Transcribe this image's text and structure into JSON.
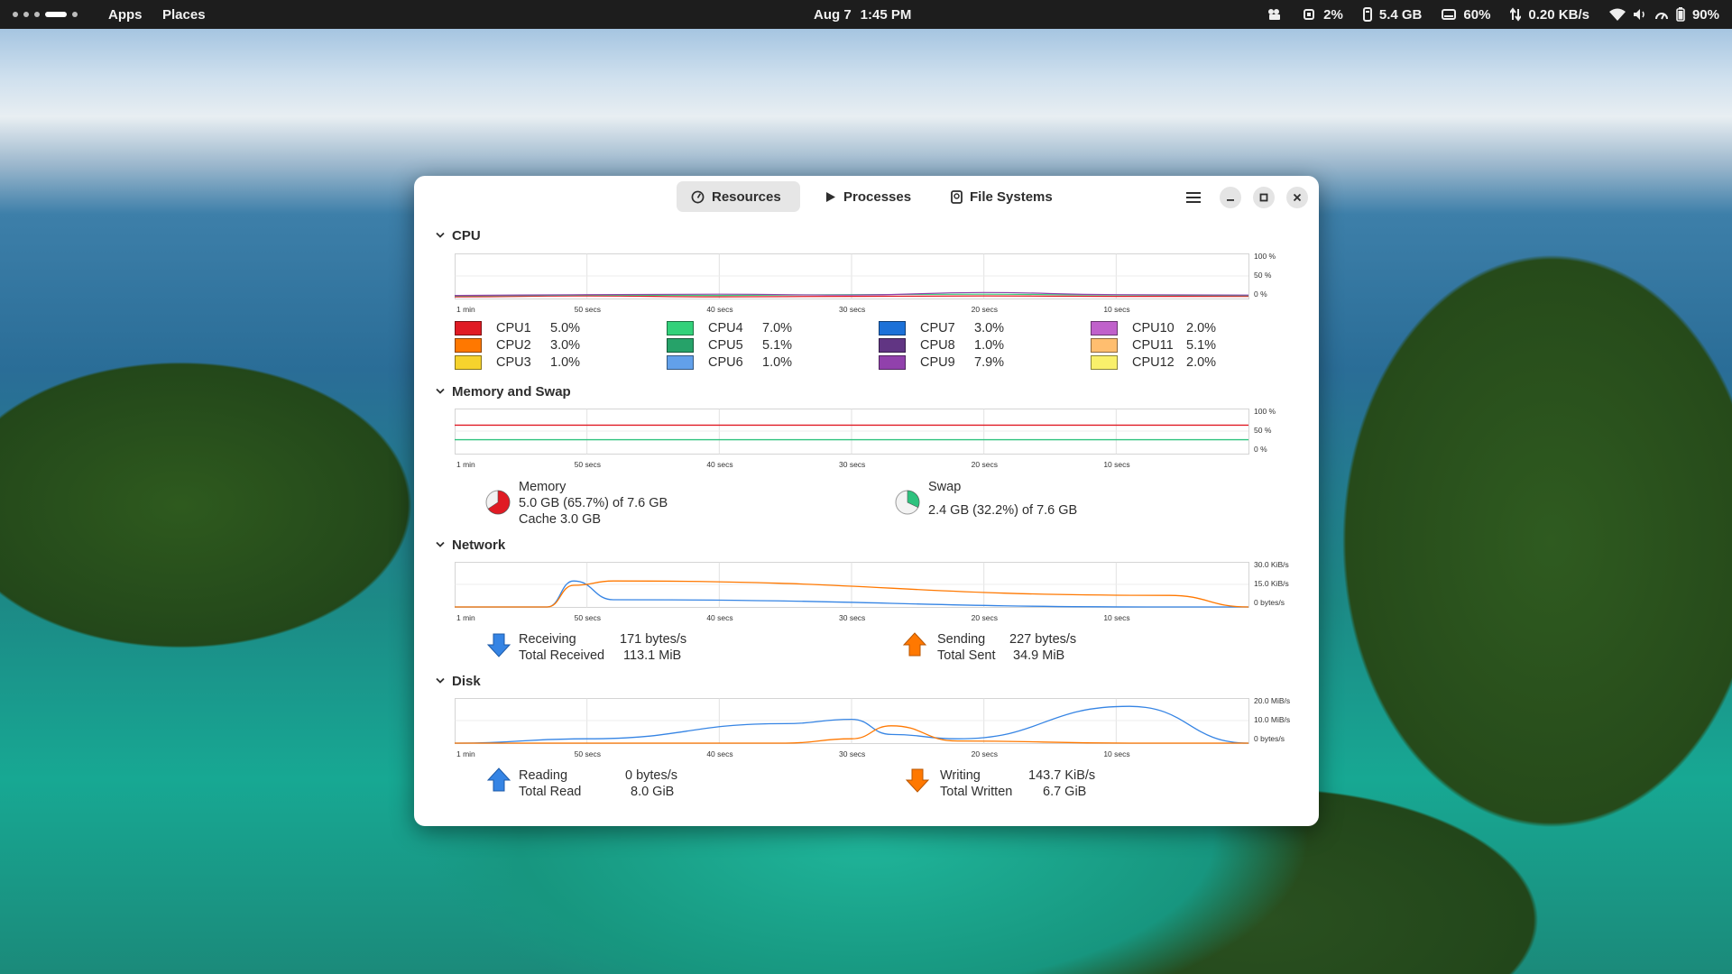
{
  "topbar": {
    "apps": "Apps",
    "places": "Places",
    "date": "Aug 7",
    "time": "1:45 PM",
    "cpu": "2%",
    "memory": "5.4 GB",
    "disk": "60%",
    "network": "0.20 KB/s",
    "battery": "90%"
  },
  "window": {
    "tabs": {
      "resources": "Resources",
      "processes": "Processes",
      "filesystems": "File Systems"
    }
  },
  "sections": {
    "cpu": "CPU",
    "memory": "Memory and Swap",
    "network": "Network",
    "disk": "Disk"
  },
  "axes": {
    "time_ticks": [
      "1 min",
      "50 secs",
      "40 secs",
      "30 secs",
      "20 secs",
      "10 secs"
    ],
    "percent_ticks": [
      "100 %",
      "50 %",
      "0 %"
    ],
    "network_ticks": [
      "30.0 KiB/s",
      "15.0 KiB/s",
      "0 bytes/s"
    ],
    "disk_ticks": [
      "20.0 MiB/s",
      "10.0 MiB/s",
      "0 bytes/s"
    ]
  },
  "cpus": [
    {
      "name": "CPU1",
      "value": "5.0%",
      "color": "#e01b24"
    },
    {
      "name": "CPU2",
      "value": "3.0%",
      "color": "#ff7800"
    },
    {
      "name": "CPU3",
      "value": "1.0%",
      "color": "#f6d32d"
    },
    {
      "name": "CPU4",
      "value": "7.0%",
      "color": "#33d17a"
    },
    {
      "name": "CPU5",
      "value": "5.1%",
      "color": "#26a269"
    },
    {
      "name": "CPU6",
      "value": "1.0%",
      "color": "#62a0ea"
    },
    {
      "name": "CPU7",
      "value": "3.0%",
      "color": "#1c71d8"
    },
    {
      "name": "CPU8",
      "value": "1.0%",
      "color": "#613583"
    },
    {
      "name": "CPU9",
      "value": "7.9%",
      "color": "#9141ac"
    },
    {
      "name": "CPU10",
      "value": "2.0%",
      "color": "#c061cb"
    },
    {
      "name": "CPU11",
      "value": "5.1%",
      "color": "#ffbe6f"
    },
    {
      "name": "CPU12",
      "value": "2.0%",
      "color": "#f9f06b"
    }
  ],
  "memory": {
    "label": "Memory",
    "usage": "5.0 GB (65.7%) of 7.6 GB",
    "cache": "Cache 3.0 GB",
    "fraction": 0.657,
    "color": "#e01b24"
  },
  "swap": {
    "label": "Swap",
    "usage": "2.4 GB (32.2%) of 7.6 GB",
    "fraction": 0.322,
    "color": "#2ec27e"
  },
  "network": {
    "receiving_label": "Receiving",
    "receiving_value": "171 bytes/s",
    "total_received_label": "Total Received",
    "total_received_value": "113.1 MiB",
    "sending_label": "Sending",
    "sending_value": "227 bytes/s",
    "total_sent_label": "Total Sent",
    "total_sent_value": "34.9 MiB"
  },
  "disk": {
    "reading_label": "Reading",
    "reading_value": "0 bytes/s",
    "total_read_label": "Total Read",
    "total_read_value": "8.0 GiB",
    "writing_label": "Writing",
    "writing_value": "143.7 KiB/s",
    "total_written_label": "Total Written",
    "total_written_value": "6.7 GiB"
  },
  "colors": {
    "receive": "#3584e4",
    "send": "#ff7800",
    "memory_line": "#e01b24",
    "swap_line": "#2ec27e"
  },
  "chart_data": [
    {
      "type": "line",
      "ylim": [
        0,
        100
      ],
      "x": [
        60,
        50,
        40,
        30,
        20,
        10,
        0
      ],
      "series": [
        {
          "name": "CPU1",
          "values": [
            4,
            6,
            4,
            5,
            6,
            5,
            5
          ]
        },
        {
          "name": "CPU4",
          "values": [
            6,
            8,
            7,
            9,
            10,
            8,
            7
          ]
        },
        {
          "name": "CPU9",
          "values": [
            7,
            9,
            10,
            8,
            14,
            9,
            8
          ]
        }
      ]
    },
    {
      "type": "line",
      "ylim": [
        0,
        100
      ],
      "x": [
        60,
        0
      ],
      "series": [
        {
          "name": "Memory",
          "values": [
            65.7,
            65.7
          ]
        },
        {
          "name": "Swap",
          "values": [
            32.2,
            32.2
          ]
        }
      ]
    },
    {
      "type": "line",
      "ylim": [
        0,
        30
      ],
      "x": [
        60,
        53,
        51,
        48,
        6,
        0
      ],
      "series": [
        {
          "name": "Receiving",
          "values": [
            0,
            0,
            18,
            5,
            0,
            0
          ]
        },
        {
          "name": "Sending",
          "values": [
            0,
            0,
            15,
            18,
            8,
            0
          ]
        }
      ]
    },
    {
      "type": "line",
      "ylim": [
        0,
        20
      ],
      "x": [
        60,
        50,
        35,
        30,
        27,
        22,
        9,
        0
      ],
      "series": [
        {
          "name": "Reading",
          "values": [
            0,
            2,
            9,
            11,
            4,
            2,
            17,
            0
          ]
        },
        {
          "name": "Writing",
          "values": [
            0,
            0,
            0,
            2,
            8,
            1,
            0,
            0
          ]
        }
      ]
    }
  ]
}
